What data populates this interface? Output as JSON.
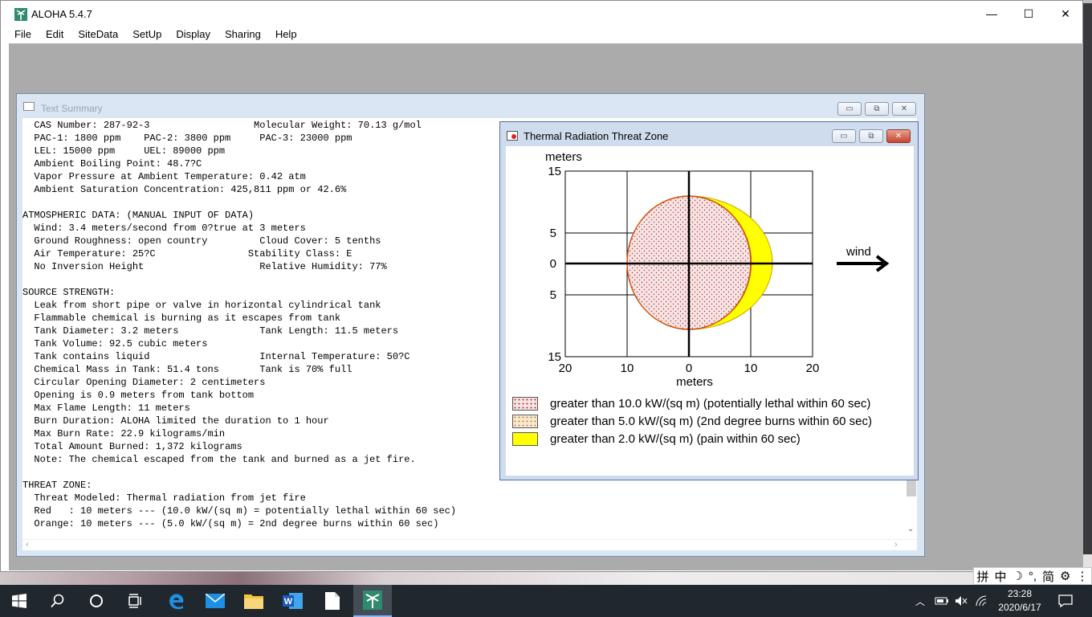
{
  "app": {
    "title": "ALOHA 5.4.7",
    "controls": {
      "minimize": "—",
      "maximize": "☐",
      "close": "✕"
    }
  },
  "menu": [
    "File",
    "Edit",
    "SiteData",
    "SetUp",
    "Display",
    "Sharing",
    "Help"
  ],
  "text_summary": {
    "title": "Text Summary",
    "lines": [
      "  CAS Number: 287-92-3                  Molecular Weight: 70.13 g/mol",
      "  PAC-1: 1800 ppm    PAC-2: 3800 ppm     PAC-3: 23000 ppm",
      "  LEL: 15000 ppm     UEL: 89000 ppm",
      "  Ambient Boiling Point: 48.7?C",
      "  Vapor Pressure at Ambient Temperature: 0.42 atm",
      "  Ambient Saturation Concentration: 425,811 ppm or 42.6%",
      "",
      "ATMOSPHERIC DATA: (MANUAL INPUT OF DATA)",
      "  Wind: 3.4 meters/second from 0?true at 3 meters",
      "  Ground Roughness: open country         Cloud Cover: 5 tenths",
      "  Air Temperature: 25?C                Stability Class: E",
      "  No Inversion Height                    Relative Humidity: 77%",
      "",
      "SOURCE STRENGTH:",
      "  Leak from short pipe or valve in horizontal cylindrical tank",
      "  Flammable chemical is burning as it escapes from tank",
      "  Tank Diameter: 3.2 meters              Tank Length: 11.5 meters",
      "  Tank Volume: 92.5 cubic meters",
      "  Tank contains liquid                   Internal Temperature: 50?C",
      "  Chemical Mass in Tank: 51.4 tons       Tank is 70% full",
      "  Circular Opening Diameter: 2 centimeters",
      "  Opening is 0.9 meters from tank bottom",
      "  Max Flame Length: 11 meters",
      "  Burn Duration: ALOHA limited the duration to 1 hour",
      "  Max Burn Rate: 22.9 kilograms/min",
      "  Total Amount Burned: 1,372 kilograms",
      "  Note: The chemical escaped from the tank and burned as a jet fire.",
      "",
      "THREAT ZONE:",
      "  Threat Modeled: Thermal radiation from jet fire",
      "  Red   : 10 meters --- (10.0 kW/(sq m) = potentially lethal within 60 sec)",
      "  Orange: 10 meters --- (5.0 kW/(sq m) = 2nd degree burns within 60 sec)"
    ]
  },
  "threat_zone": {
    "title": "Thermal Radiation Threat Zone",
    "y_axis_label": "meters",
    "x_axis_label": "meters",
    "y_ticks": [
      "15",
      "5",
      "0",
      "5",
      "15"
    ],
    "x_ticks": [
      "20",
      "10",
      "0",
      "10",
      "20"
    ],
    "wind_label": "wind",
    "legend": [
      {
        "label": "greater than 10.0 kW/(sq m) (potentially lethal within 60 sec)",
        "color": "#f2dede",
        "pattern": "red-dots"
      },
      {
        "label": "greater than 5.0 kW/(sq m) (2nd degree burns within 60 sec)",
        "color": "#f3e3b8",
        "pattern": "orange-dots"
      },
      {
        "label": "greater than 2.0 kW/(sq m) (pain within 60 sec)",
        "color": "#ffff00",
        "pattern": "solid"
      }
    ]
  },
  "tray": {
    "time": "23:28",
    "date": "2020/6/17",
    "ime": [
      "拼",
      "中",
      "☽",
      "°,",
      "简",
      "⚙",
      "⋮"
    ]
  }
}
